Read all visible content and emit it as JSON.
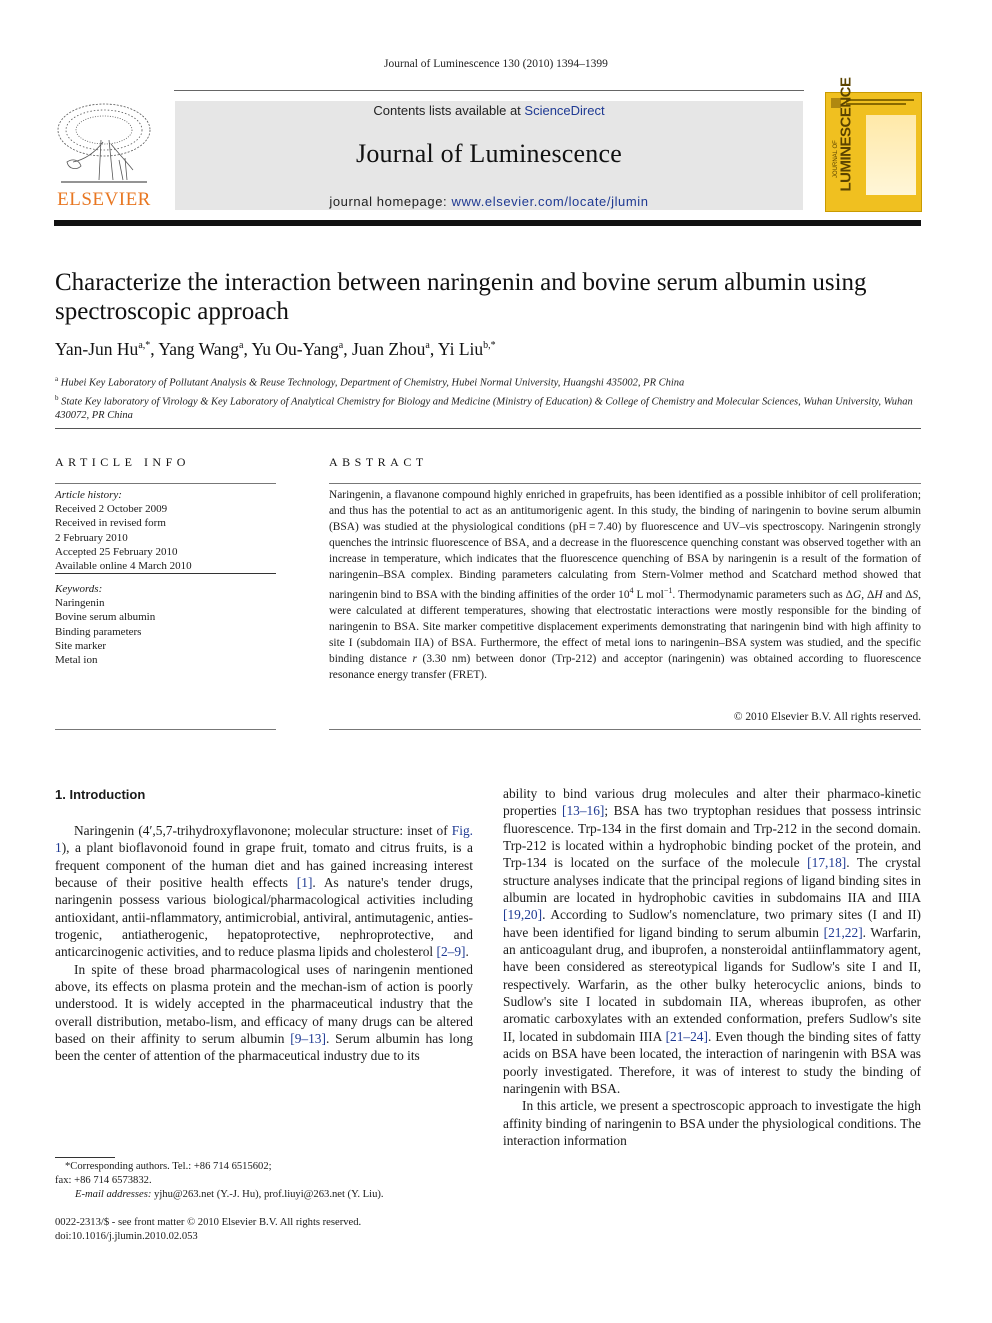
{
  "running_head": "Journal of Luminescence 130 (2010) 1394–1399",
  "masthead": {
    "publisher_logo_text": "ELSEVIER",
    "contents_prefix": "Contents lists available at ",
    "contents_link": "ScienceDirect",
    "journal_title": "Journal of Luminescence",
    "homepage_prefix": "journal homepage: ",
    "homepage_link": "www.elsevier.com/locate/jlumin",
    "cover_title": "LUMINESCENCE",
    "cover_subtitle": "JOURNAL OF",
    "colors": {
      "logo_orange": "#e87722",
      "cover_yellow": "#f0c020",
      "link_blue": "#1f3a93",
      "banner_gray": "#e6e6e6"
    }
  },
  "article": {
    "title": "Characterize the interaction between naringenin and bovine serum albumin using spectroscopic approach",
    "authors": [
      {
        "name": "Yan-Jun Hu",
        "sup": "a,*"
      },
      {
        "name": "Yang Wang",
        "sup": "a"
      },
      {
        "name": "Yu Ou-Yang",
        "sup": "a"
      },
      {
        "name": "Juan Zhou",
        "sup": "a"
      },
      {
        "name": "Yi Liu",
        "sup": "b,*"
      }
    ],
    "affiliations": [
      {
        "label": "a",
        "text": "Hubei Key Laboratory of Pollutant Analysis & Reuse Technology, Department of Chemistry, Hubei Normal University, Huangshi 435002, PR China"
      },
      {
        "label": "b",
        "text": "State Key laboratory of Virology & Key Laboratory of Analytical Chemistry for Biology and Medicine (Ministry of Education) & College of Chemistry and Molecular Sciences, Wuhan University, Wuhan 430072, PR China"
      }
    ]
  },
  "article_info": {
    "heading": "ARTICLE INFO",
    "history_label": "Article history:",
    "history": [
      "Received 2 October 2009",
      "Received in revised form",
      "2 February 2010",
      "Accepted 25 February 2010",
      "Available online 4 March 2010"
    ],
    "keywords_label": "Keywords:",
    "keywords": [
      "Naringenin",
      "Bovine serum albumin",
      "Binding parameters",
      "Site marker",
      "Metal ion"
    ]
  },
  "abstract": {
    "heading": "ABSTRACT",
    "text_1": "Naringenin, a flavanone compound highly enriched in grapefruits, has been identified as a possible inhibitor of cell proliferation; and thus has the potential to act as an antitumorigenic agent. In this study, the binding of naringenin to bovine serum albumin (BSA) was studied at the physiological conditions (pH = 7.40) by fluorescence and UV–vis spectroscopy. Naringenin strongly quenches the intrinsic fluorescence of BSA, and a decrease in the fluorescence quenching constant was observed together with an increase in temperature, which indicates that the fluorescence quenching of BSA by naringenin is a result of the formation of naringenin–BSA complex. Binding parameters calculating from Stern-Volmer method and Scatchard method showed that naringenin bind to BSA with the binding affinities of the order 10",
    "exp_4": "4",
    "unit": " L mol",
    "exp_m1": "−1",
    "text_2": ". Thermodynamic parameters such as Δ",
    "G": "G",
    "text_3": ", Δ",
    "H": "H",
    "text_4": " and Δ",
    "S": "S",
    "text_5": ", were calculated at different temperatures, showing that electrostatic interactions were mostly responsible for the binding of naringenin to BSA. Site marker competitive displacement experiments demonstrating that naringenin bind with high affinity to site I (subdomain IIA) of BSA. Furthermore, the effect of metal ions to naringenin–BSA system was studied, and the specific binding distance ",
    "r": "r",
    "text_6": " (3.30 nm) between donor (Trp-212) and acceptor (naringenin) was obtained according to fluorescence resonance energy transfer (FRET).",
    "copyright": "© 2010 Elsevier B.V. All rights reserved."
  },
  "intro": {
    "heading": "1.  Introduction",
    "p1_a": "Naringenin (4′,5,7-trihydroxyflavonone; molecular structure: inset of ",
    "p1_fig": "Fig. 1",
    "p1_b": "), a plant bioflavonoid found in grape fruit, tomato and citrus fruits, is a frequent component of the human diet and has gained increasing interest because of their positive health effects ",
    "p1_ref1": "[1]",
    "p1_c": ". As nature's tender drugs, naringenin possess various biological/pharmacological activities including antioxidant, antii-nflammatory, antimicrobial, antiviral, antimutagenic, anties-trogenic, antiatherogenic, hepatoprotective, nephroprotective, and anticarcinogenic activities, and to reduce plasma lipids and cholesterol ",
    "p1_ref2": "[2–9]",
    "p1_d": ".",
    "p2_a": "In spite of these broad pharmacological uses of naringenin mentioned above, its effects on plasma protein and the mechan-ism of action is poorly understood. It is widely accepted in the pharmaceutical industry that the overall distribution, metabo-lism, and efficacy of many drugs can be altered based on their affinity to serum albumin ",
    "p2_ref": "[9–13]",
    "p2_b": ". Serum albumin has long been the center of attention of the pharmaceutical industry due to its ability to bind various drug molecules and alter their pharmaco-kinetic properties ",
    "p2_ref2": "[13–16]",
    "p2_c": "; BSA has two tryptophan residues that possess intrinsic fluorescence. Trp-134 in the first domain and Trp-212 in the second domain. Trp-212 is located within a hydrophobic binding pocket of the protein, and Trp-134 is located on the surface of the molecule ",
    "p2_ref3": "[17,18]",
    "p2_d": ". The crystal structure analyses indicate that the principal regions of ligand binding sites in albumin are located in hydrophobic cavities in subdomains IIA and IIIA ",
    "p2_ref4": "[19,20]",
    "p2_e": ". According to Sudlow's nomenclature, two primary sites (I and II) have been identified for ligand binding to serum albumin ",
    "p2_ref5": "[21,22]",
    "p2_f": ". Warfarin, an anticoagulant drug, and ibuprofen, a nonsteroidal antiinflammatory agent, have been considered as stereotypical ligands for Sudlow's site I and II, respectively. Warfarin, as the other bulky heterocyclic anions, binds to Sudlow's site I located in subdomain IIA, whereas ibuprofen, as other aromatic carboxylates with an extended conformation, prefers Sudlow's site II, located in subdomain IIIA ",
    "p2_ref6": "[21–24]",
    "p2_g": ". Even though the binding sites of fatty acids on BSA have been located, the interaction of naringenin with BSA was poorly investigated. Therefore, it was of interest to study the binding of naringenin with BSA.",
    "p3": "In this article, we present a spectroscopic approach to investigate the high affinity binding of naringenin to BSA under the physiological conditions. The interaction information"
  },
  "footnotes": {
    "corresponding": "*Corresponding authors. Tel.: +86 714 6515602;",
    "fax": "fax: +86 714 6573832.",
    "email_label": "E-mail addresses:",
    "emails": " yjhu@263.net (Y.-J. Hu), prof.liuyi@263.net (Y. Liu).",
    "issn": "0022-2313/$ - see front matter © 2010 Elsevier B.V. All rights reserved.",
    "doi": "doi:10.1016/j.jlumin.2010.02.053"
  }
}
